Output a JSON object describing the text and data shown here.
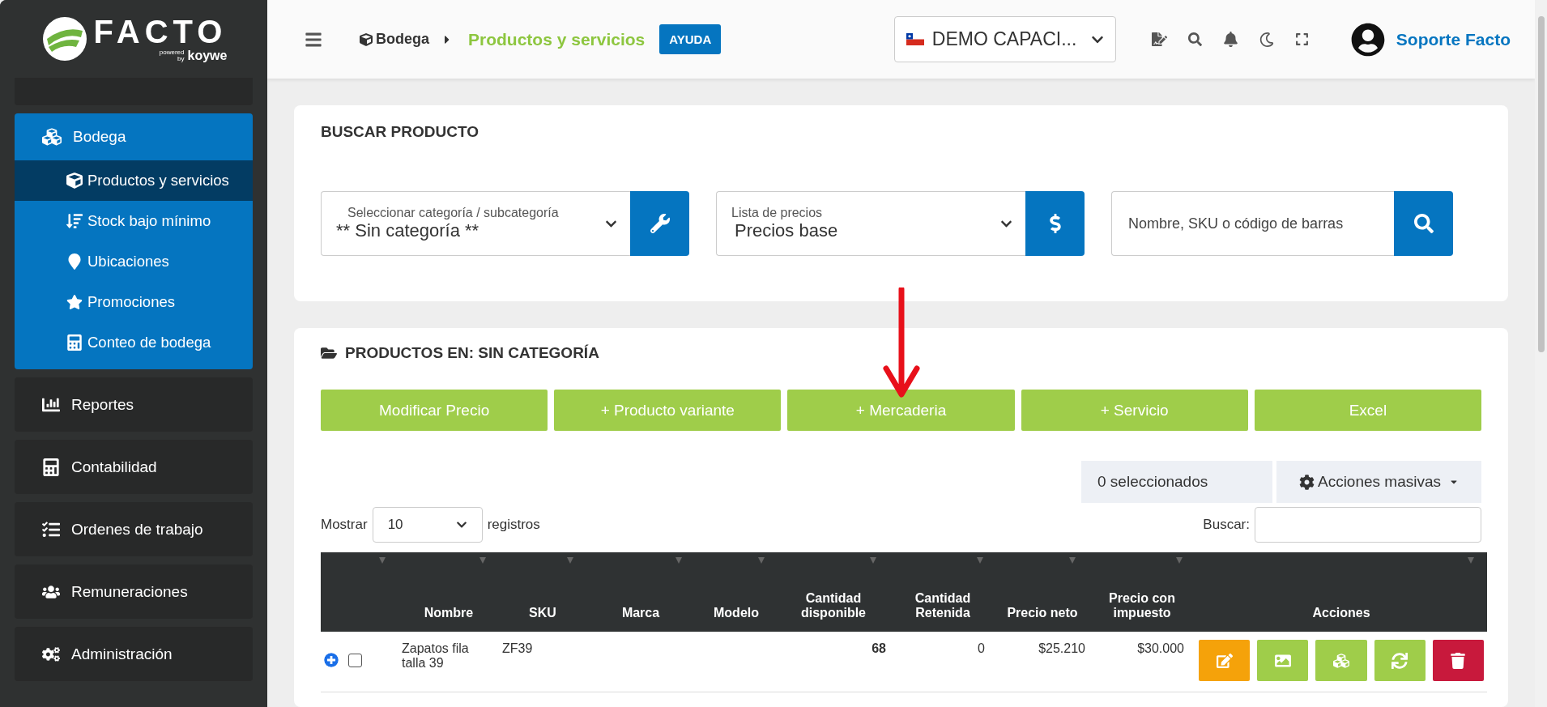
{
  "logo": {
    "name": "FACTO",
    "powered": "powered",
    "by": "by",
    "brand": "koywe"
  },
  "sidebar": {
    "items": [
      {
        "label": "Bodega",
        "expanded": true,
        "children": [
          {
            "label": "Productos y servicios",
            "selected": true
          },
          {
            "label": "Stock bajo mínimo",
            "selected": false
          },
          {
            "label": "Ubicaciones",
            "selected": false
          },
          {
            "label": "Promociones",
            "selected": false
          },
          {
            "label": "Conteo de bodega",
            "selected": false
          }
        ]
      },
      {
        "label": "Reportes",
        "expanded": false
      },
      {
        "label": "Contabilidad",
        "expanded": false
      },
      {
        "label": "Ordenes de trabajo",
        "expanded": false
      },
      {
        "label": "Remuneraciones",
        "expanded": false
      },
      {
        "label": "Administración",
        "expanded": false
      }
    ]
  },
  "header": {
    "breadcrumb": [
      "Bodega",
      "Productos y servicios"
    ],
    "help": "AYUDA",
    "company": "DEMO CAPACI...",
    "user": "Soporte Facto"
  },
  "search": {
    "title": "BUSCAR PRODUCTO",
    "category": {
      "label": "Seleccionar categoría / subcategoría",
      "value": "** Sin categoría **"
    },
    "price_list": {
      "label": "Lista de precios",
      "value": "Precios base"
    },
    "query": {
      "placeholder": "Nombre, SKU o código de barras"
    }
  },
  "products": {
    "title": "PRODUCTOS EN: SIN CATEGORÍA",
    "buttons": [
      "Modificar Precio",
      "+ Producto variante",
      "+ Mercaderia",
      "+ Servicio",
      "Excel"
    ],
    "selected_count": "0 seleccionados",
    "bulk_actions": "Acciones masivas",
    "show_label": "Mostrar",
    "page_size": "10",
    "records_label": "registros",
    "search_label": "Buscar:",
    "table": {
      "columns": [
        "Nombre",
        "SKU",
        "Marca",
        "Modelo",
        "Cantidad disponible",
        "Cantidad Retenida",
        "Precio neto",
        "Precio con impuesto",
        "Acciones"
      ],
      "rows": [
        {
          "name": "Zapatos fila talla 39",
          "sku": "ZF39",
          "available": "68",
          "retained": "0",
          "net_price": "$25.210",
          "price_with_tax": "$30.000",
          "checked": false
        }
      ]
    }
  }
}
